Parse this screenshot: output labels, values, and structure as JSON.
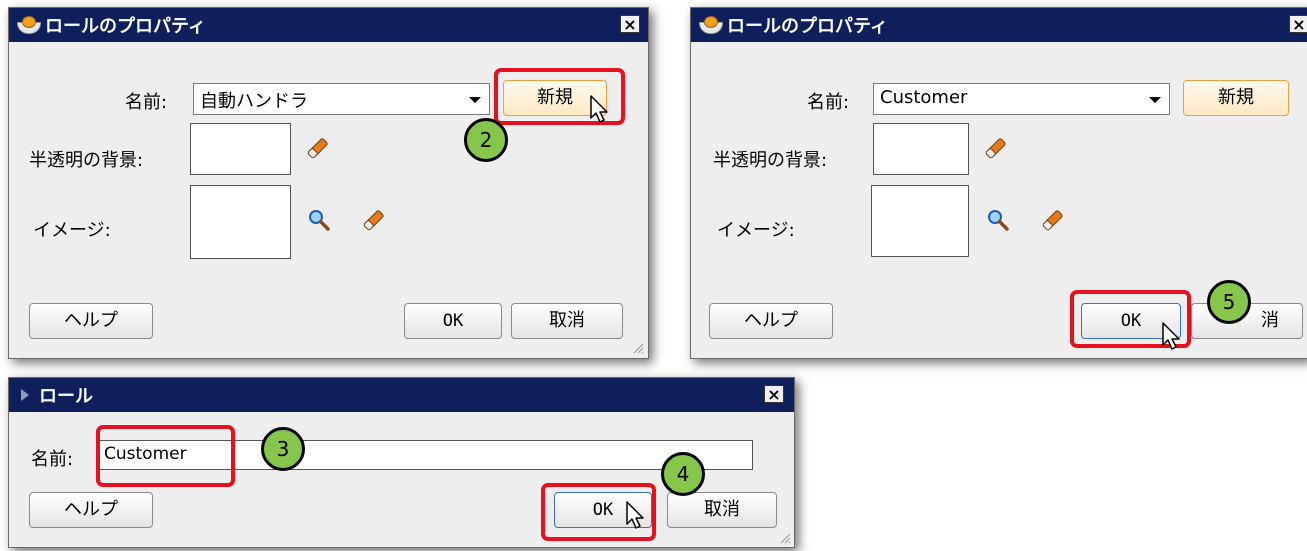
{
  "dialogs": {
    "left": {
      "title": "ロールのプロパティ",
      "close": "×",
      "name_label": "名前:",
      "name_value": "自動ハンドラ",
      "new_button": "新規",
      "translucent_label": "半透明の背景:",
      "image_label": "イメージ:",
      "help_button": "ヘルプ",
      "ok_button": "OK",
      "cancel_button": "取消"
    },
    "right": {
      "title": "ロールのプロパティ",
      "close": "×",
      "name_label": "名前:",
      "name_value": "Customer",
      "new_button": "新規",
      "translucent_label": "半透明の背景:",
      "image_label": "イメージ:",
      "help_button": "ヘルプ",
      "ok_button": "OK",
      "cancel_button_visible": "消"
    },
    "role": {
      "title": "ロール",
      "close": "×",
      "name_label": "名前:",
      "name_value": "Customer",
      "help_button": "ヘルプ",
      "ok_button": "OK",
      "cancel_button": "取消"
    }
  },
  "steps": [
    "2",
    "3",
    "4",
    "5"
  ],
  "icons": [
    "teapot-icon",
    "eraser-icon",
    "magnifier-icon",
    "close-icon",
    "dropdown-arrow-icon",
    "cursor-icon",
    "resize-grip-icon"
  ],
  "colors": {
    "titlebar": "#0f1f5c",
    "dialog_bg": "#eeeeee",
    "highlight": "#e8101e",
    "step_badge": "#86c64a",
    "new_button_border": "#e8a040"
  }
}
